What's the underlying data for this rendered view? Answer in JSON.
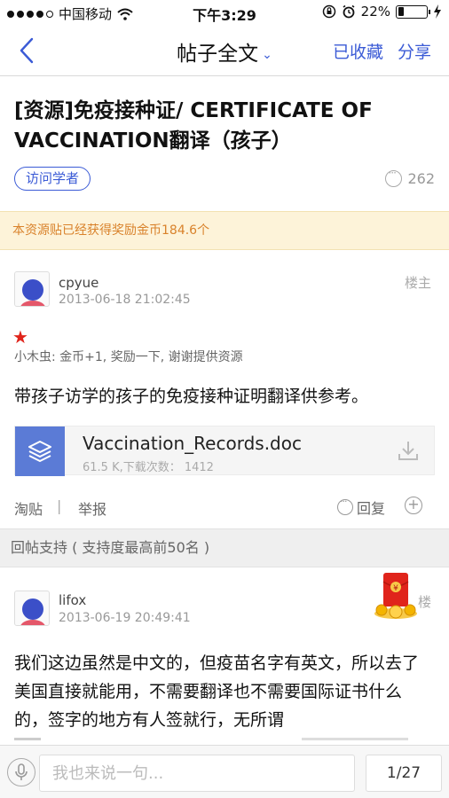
{
  "status_bar": {
    "carrier": "中国移动",
    "time": "下午3:29",
    "battery": "22%",
    "battery_level": 0.22
  },
  "nav": {
    "title": "帖子全文",
    "favorited_label": "已收藏",
    "share_label": "分享"
  },
  "post": {
    "title": "[资源]免疫接种证/ CERTIFICATE OF VACCINATION翻译（孩子）",
    "tag": "访问学者",
    "views": "262",
    "banner": "本资源贴已经获得奖励金币184.6个"
  },
  "first_post": {
    "user": "cpyue",
    "time": "2013-06-18 21:02:45",
    "floor": "楼主",
    "star": "★",
    "reward_note": "小木虫: 金币+1, 奖励一下, 谢谢提供资源",
    "text": "带孩子访学的孩子的免疫接种证明翻译供参考。",
    "attachment": {
      "name": "Vaccination_Records.doc",
      "meta": "61.5 K,下载次数：   1412"
    },
    "actions": {
      "tao": "淘贴",
      "separator": "|",
      "report": "举报",
      "reply": "回复",
      "plus": "+"
    }
  },
  "section": {
    "label": "回帖支持 ( 支持度最高前50名 )"
  },
  "second_post": {
    "user": "lifox",
    "time": "2013-06-19 20:49:41",
    "floor": "楼",
    "text": "我们这边虽然是中文的，但疫苗名字有英文，所以去了美国直接就能用，不需要翻译也不需要国际证书什么的，签字的地方有人签就行，无所谓"
  },
  "bottom": {
    "placeholder": "我也来说一句...",
    "page": "1/27"
  },
  "colors": {
    "accent": "#3b5bd6",
    "banner_bg": "#fdf3d9",
    "banner_text": "#d9822b",
    "star": "#e0241b"
  }
}
